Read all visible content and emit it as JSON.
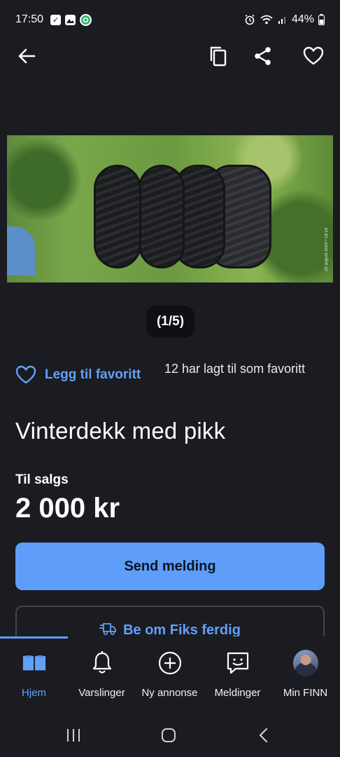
{
  "status_bar": {
    "time": "17:50",
    "battery": "44%",
    "left_icons": [
      "checkbox-notification-icon",
      "gallery-notification-icon",
      "sync-app-icon"
    ],
    "right_icons": [
      "alarm-icon",
      "wifi-icon",
      "signal-icon",
      "battery-icon"
    ]
  },
  "top_bar": {
    "icons": [
      "back-arrow-icon",
      "copy-icon",
      "share-icon",
      "heart-icon"
    ]
  },
  "gallery": {
    "counter": "(1/5)",
    "photo_caption": "29 august 2024 • 18:14"
  },
  "favorite": {
    "button_label": "Legg til favoritt",
    "count_text": "12 har lagt til som favoritt"
  },
  "listing": {
    "title": "Vinterdekk med pikk",
    "sale_label": "Til salgs",
    "price": "2 000 kr"
  },
  "actions": {
    "send_label": "Send melding",
    "fiks_label": "Be om Fiks ferdig"
  },
  "bottom_nav": {
    "items": [
      {
        "label": "Hjem",
        "icon": "home-book-icon",
        "active": true
      },
      {
        "label": "Varslinger",
        "icon": "bell-icon",
        "active": false
      },
      {
        "label": "Ny annonse",
        "icon": "plus-circle-icon",
        "active": false
      },
      {
        "label": "Meldinger",
        "icon": "chat-icon",
        "active": false
      },
      {
        "label": "Min FINN",
        "icon": "avatar",
        "active": false
      }
    ]
  },
  "colors": {
    "background": "#1b1b22",
    "accent": "#5e9dfa",
    "link": "#62a1f8"
  }
}
